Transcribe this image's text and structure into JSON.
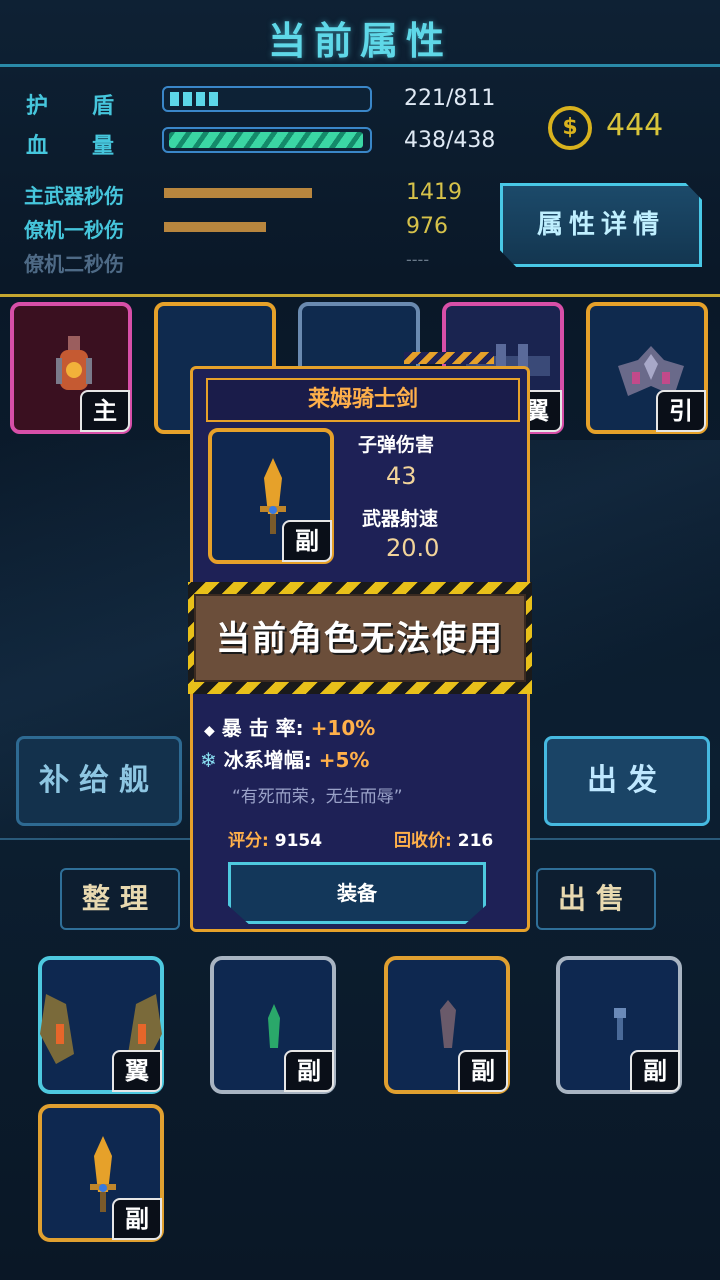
{
  "header": {
    "title": "当前属性"
  },
  "stats": {
    "shield_label": "护　　盾",
    "shield_value": "221/811",
    "shield_ratio": 0.27,
    "hp_label": "血　　量",
    "hp_value": "438/438",
    "hp_ratio": 1.0,
    "coins": "444",
    "coin_symbol": "$"
  },
  "dps": [
    {
      "label": "主武器秒伤",
      "value": "1419",
      "ratio": 0.69
    },
    {
      "label": "僚机一秒伤",
      "value": "976",
      "ratio": 0.47
    },
    {
      "label": "僚机二秒伤",
      "value": "----",
      "ratio": 0
    }
  ],
  "buttons": {
    "detail": "属性详情",
    "supply": "补给舰",
    "depart": "出发",
    "sort": "整理",
    "sell": "出售"
  },
  "equip_slots": [
    {
      "tag": "主"
    },
    {
      "tag": ""
    },
    {
      "tag": ""
    },
    {
      "tag": "翼"
    },
    {
      "tag": "引"
    }
  ],
  "popup": {
    "name": "莱姆骑士剑",
    "slot_tag": "副",
    "bullet_damage_label": "子弹伤害",
    "bullet_damage": "43",
    "fire_rate_label": "武器射速",
    "fire_rate": "20.0",
    "warning": "当前角色无法使用",
    "crit_label": "暴 击 率:",
    "crit_value": "+10%",
    "ice_label": "冰系增幅:",
    "ice_value": "+5%",
    "quote": "“有死而荣，无生而辱”",
    "score_label": "评分:",
    "score": "9154",
    "recycle_label": "回收价:",
    "recycle": "216",
    "equip_button": "装备"
  },
  "inventory": [
    {
      "tag": "翼"
    },
    {
      "tag": "副"
    },
    {
      "tag": "副"
    },
    {
      "tag": "副"
    },
    {
      "tag": "副"
    }
  ],
  "colors": {
    "accent": "#46c6dc",
    "gold": "#e6a12a",
    "pink": "#d74fa8"
  }
}
